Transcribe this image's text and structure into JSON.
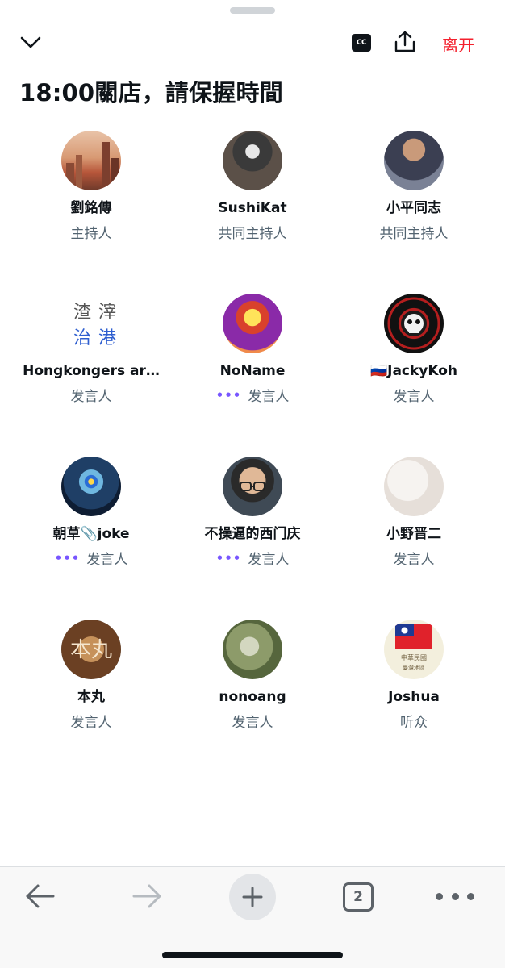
{
  "header": {
    "cc_label": "CC",
    "leave_label": "离开"
  },
  "space": {
    "title": "18:00關店，請保握時間"
  },
  "participants": [
    {
      "name": "劉銘傳",
      "role": "主持人",
      "speaking": false,
      "avatar": "city-sunset-photo"
    },
    {
      "name": "SushiKat",
      "role": "共同主持人",
      "speaking": false,
      "avatar": "masked-figure-photo"
    },
    {
      "name": "小平同志",
      "role": "共同主持人",
      "speaking": false,
      "avatar": "man-portrait-photo"
    },
    {
      "name": "Hongkongers ar…",
      "role": "发言人",
      "speaking": false,
      "avatar": "calligraphy-logo",
      "avatar_text": [
        "渣",
        "滓",
        "治",
        "港"
      ]
    },
    {
      "name": "NoName",
      "role": "发言人",
      "speaking": true,
      "avatar": "colorful-warrior-art"
    },
    {
      "name": "🇷🇺JackyKoh",
      "role": "发言人",
      "speaking": false,
      "avatar": "pmc-wagner-skull-logo",
      "avatar_text": [
        "PMC Wagner Group",
        "Группа Вагнера"
      ]
    },
    {
      "name": "朝草📎joke",
      "role": "发言人",
      "speaking": true,
      "avatar": "hand-with-orb-art"
    },
    {
      "name": "不操逼的西门庆",
      "role": "发言人",
      "speaking": true,
      "avatar": "glasses-portrait-photo"
    },
    {
      "name": "小野晋二",
      "role": "发言人",
      "speaking": false,
      "avatar": "white-texture"
    },
    {
      "name": "本丸",
      "role": "发言人",
      "speaking": false,
      "avatar": "wood-sign-photo",
      "avatar_text": [
        "本丸"
      ]
    },
    {
      "name": "nonoang",
      "role": "发言人",
      "speaking": false,
      "avatar": "garden-photo"
    },
    {
      "name": "Joshua",
      "role": "听众",
      "speaking": false,
      "avatar": "roc-flag-seal",
      "avatar_text": [
        "中華民國",
        "臺灣地區"
      ]
    }
  ],
  "browser_nav": {
    "tab_count": "2"
  },
  "icons": {
    "collapse": "chevron-down-icon",
    "captions": "closed-captions-icon",
    "share": "share-icon",
    "back": "arrow-left-icon",
    "forward": "arrow-right-icon",
    "new_tab": "plus-icon",
    "tabs": "tabs-icon",
    "more": "more-icon"
  },
  "colors": {
    "leave": "#f4212e",
    "speaking_dots": "#7856ff",
    "role_text": "#536471"
  }
}
